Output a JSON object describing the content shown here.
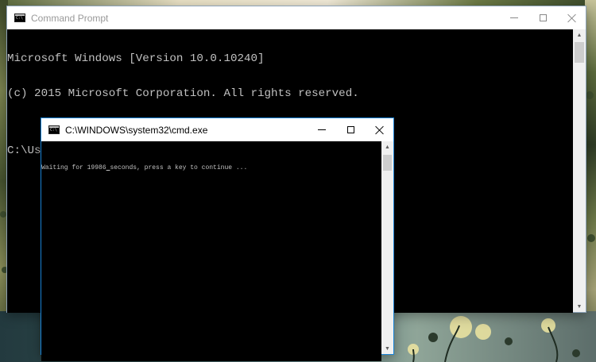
{
  "windows": {
    "main": {
      "title": "Command Prompt",
      "lines": [
        "Microsoft Windows [Version 10.0.10240]",
        "(c) 2015 Microsoft Corporation. All rights reserved.",
        "",
        "C:\\Users\\dev>"
      ],
      "icons": {
        "app": "cmd-icon",
        "minimize": "minimize-icon",
        "maximize": "maximize-icon",
        "close": "close-icon"
      }
    },
    "child": {
      "title": "C:\\WINDOWS\\system32\\cmd.exe",
      "message_before": "Waiting for 19986",
      "message_after": "seconds, press a key to continue ...",
      "icons": {
        "app": "cmd-icon",
        "minimize": "minimize-icon",
        "maximize": "maximize-icon",
        "close": "close-icon"
      }
    }
  },
  "scrollbar": {
    "up_arrow": "▲",
    "down_arrow": "▼"
  },
  "colors": {
    "console_bg": "#000000",
    "console_text": "#c0c0c0",
    "titlebar_bg": "#ffffff",
    "active_border": "#1883d7",
    "inactive_title_text": "#999999"
  }
}
